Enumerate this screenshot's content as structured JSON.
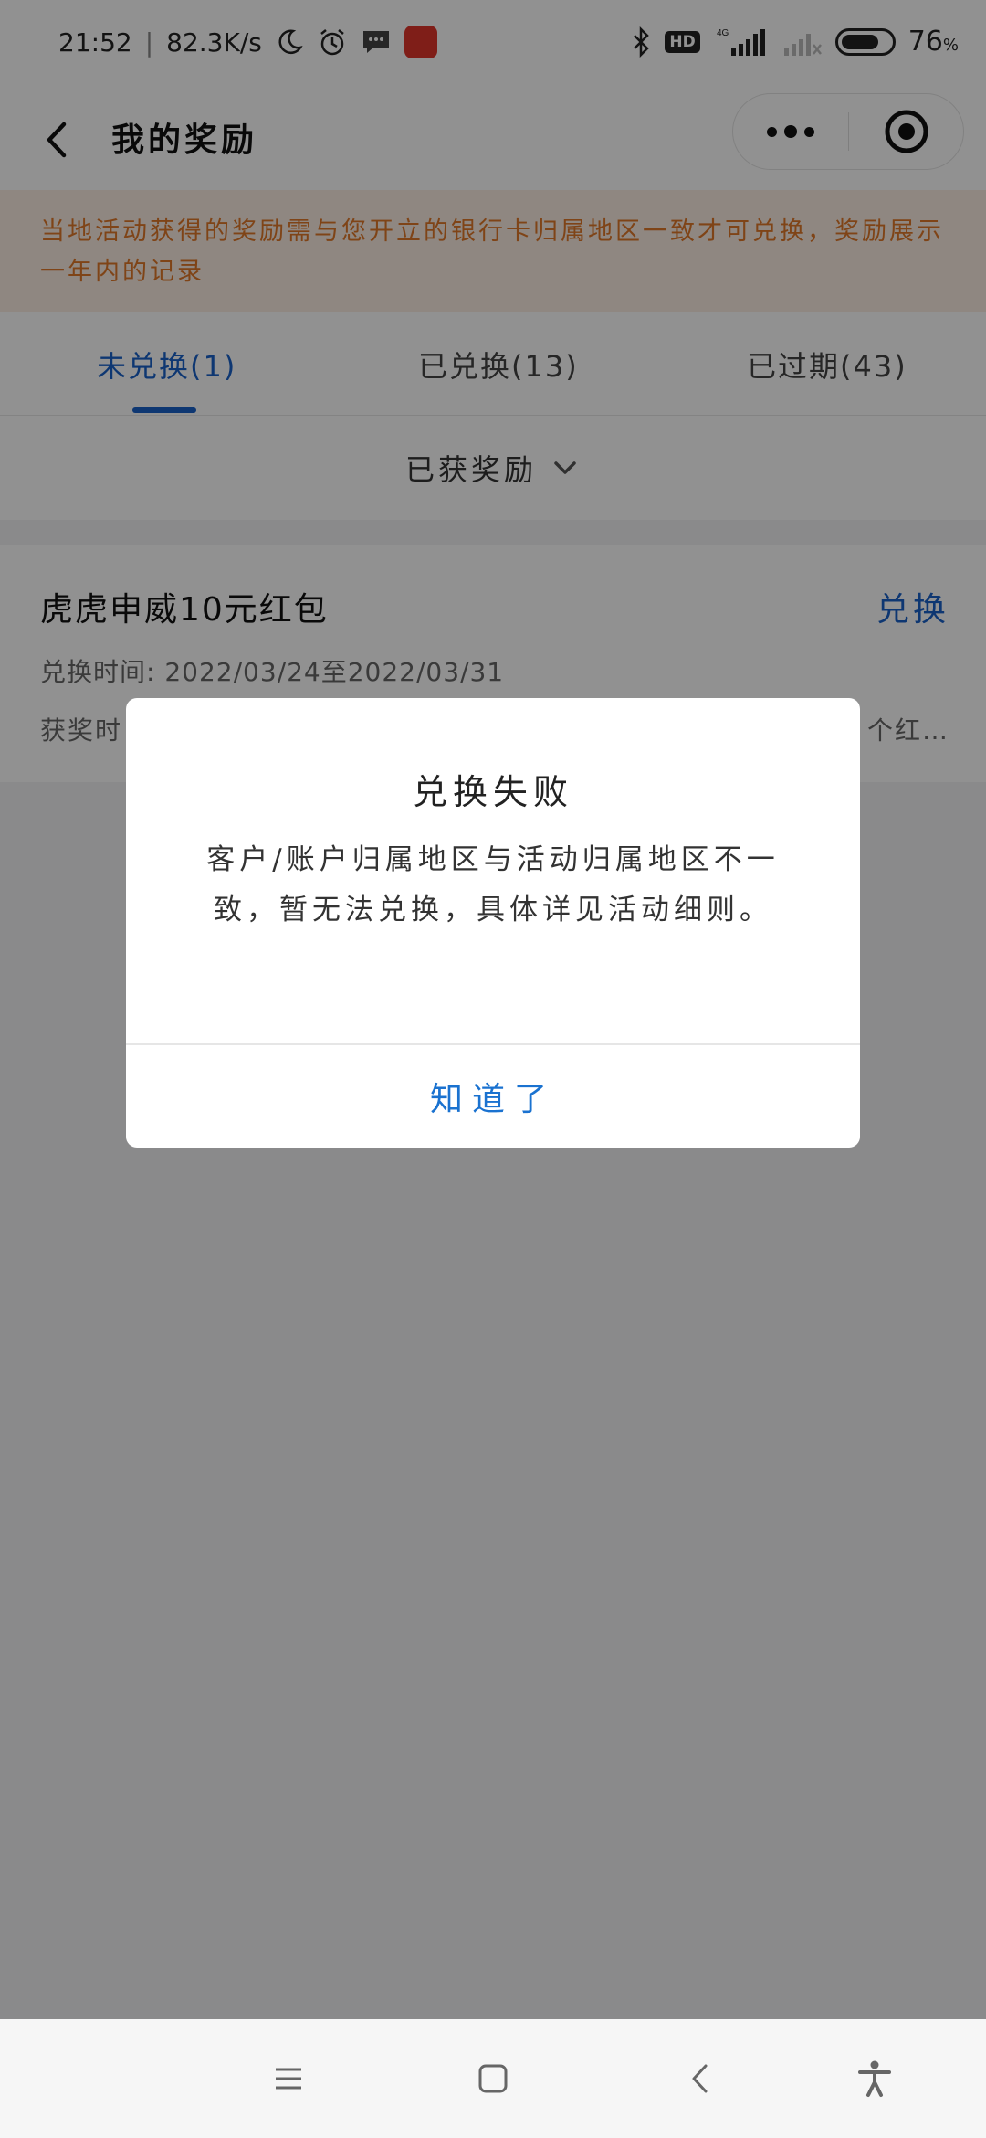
{
  "status_bar": {
    "time": "21:52",
    "separator": "|",
    "speed": "82.3K/s",
    "network": "4G",
    "hd": "HD",
    "battery": "76",
    "battery_unit": "%",
    "battery_level": 0.76
  },
  "header": {
    "title": "我的奖励"
  },
  "notice": {
    "text": "当地活动获得的奖励需与您开立的银行卡归属地区一致才可兑换，奖励展示一年内的记录"
  },
  "tabs": [
    {
      "label": "未兑换(1)"
    },
    {
      "label": "已兑换(13)"
    },
    {
      "label": "已过期(43)"
    }
  ],
  "filter": {
    "label": "已获奖励"
  },
  "reward": {
    "title": "虎虎申威10元红包",
    "action": "兑换",
    "period": "兑换时间: 2022/03/24至2022/03/31",
    "award_prefix": "获奖时",
    "award_suffix": "个红…"
  },
  "dialog": {
    "title": "兑换失败",
    "message": "客户/账户归属地区与活动归属地区不一致，暂无法兑换，具体详见活动细则。",
    "confirm": "知道了"
  },
  "colors": {
    "accent": "#1a62c8",
    "notice_text": "#e0782a",
    "notice_bg": "#fbede3"
  }
}
